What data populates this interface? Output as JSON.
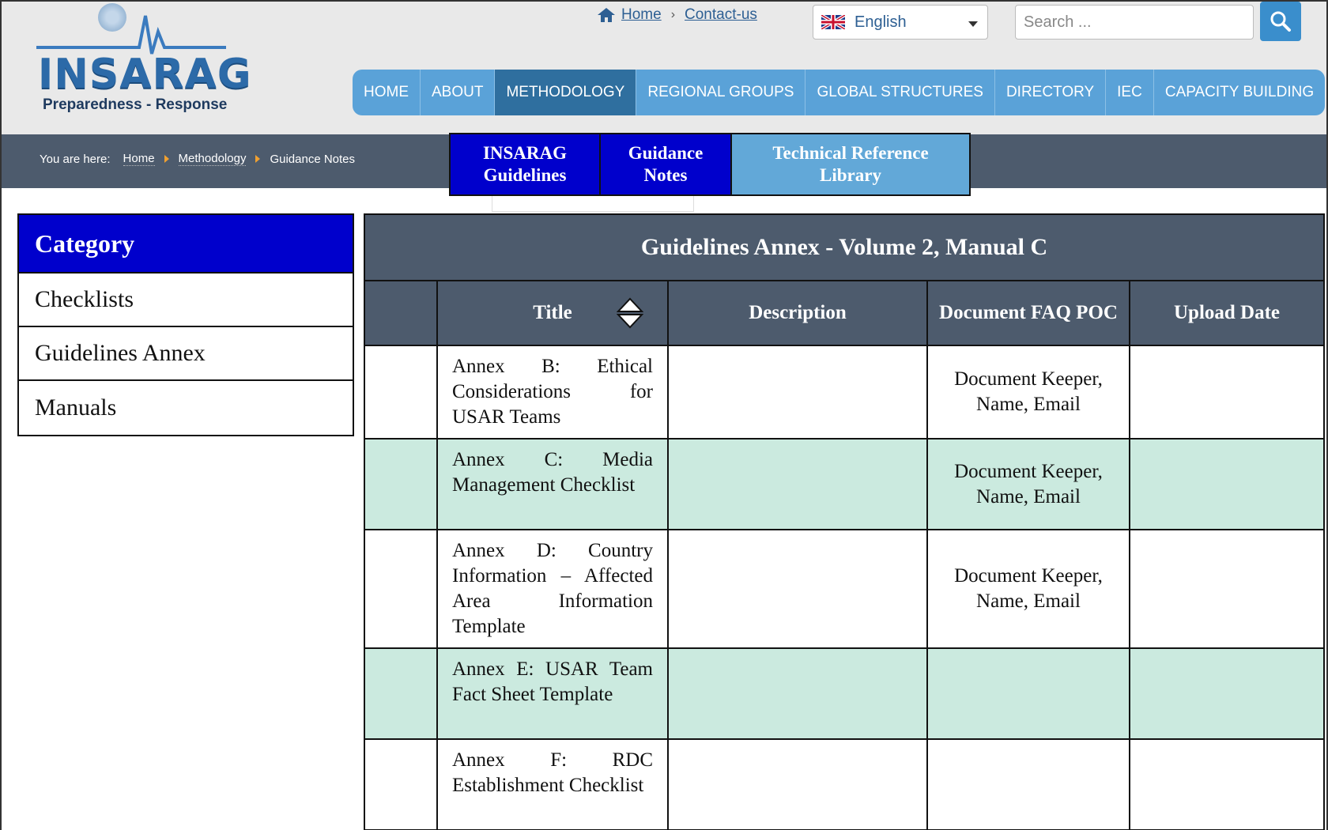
{
  "logo": {
    "wordmark": "INSARAG",
    "tagline": "Preparedness - Response"
  },
  "utility_links": {
    "home": "Home",
    "separator": "›",
    "contact": "Contact-us"
  },
  "language": {
    "selected": "English"
  },
  "search": {
    "placeholder": "Search ..."
  },
  "nav": [
    {
      "label": "HOME"
    },
    {
      "label": "ABOUT"
    },
    {
      "label": "METHODOLOGY",
      "active": true
    },
    {
      "label": "REGIONAL GROUPS"
    },
    {
      "label": "GLOBAL STRUCTURES"
    },
    {
      "label": "DIRECTORY"
    },
    {
      "label": "IEC"
    },
    {
      "label": "CAPACITY BUILDING"
    }
  ],
  "breadcrumb": {
    "prefix": "You are here:",
    "items": [
      "Home",
      "Methodology",
      "Guidance Notes"
    ]
  },
  "subtabs": [
    {
      "label": "INSARAG Guidelines"
    },
    {
      "label": "Guidance Notes"
    },
    {
      "label": "Technical Reference Library"
    }
  ],
  "category": {
    "heading": "Category",
    "items": [
      "Checklists",
      "Guidelines Annex",
      "Manuals"
    ]
  },
  "table": {
    "caption": "Guidelines Annex - Volume 2, Manual C",
    "columns": {
      "title": "Title",
      "description": "Description",
      "poc": "Document FAQ POC",
      "upload": "Upload Date"
    },
    "rows": [
      {
        "title": "Annex B: Ethical Considerations for USAR Teams",
        "description": "",
        "poc": "Document Keeper, Name, Email",
        "upload": ""
      },
      {
        "title": "Annex C: Media Management Checklist",
        "description": "",
        "poc": "Document Keeper, Name, Email",
        "upload": ""
      },
      {
        "title": "Annex D: Country Information – Affected Area Information Template",
        "description": "",
        "poc": "Document Keeper, Name, Email",
        "upload": ""
      },
      {
        "title": "Annex E: USAR Team Fact Sheet Template",
        "description": "",
        "poc": "",
        "upload": ""
      },
      {
        "title": "Annex F: RDC Establishment Checklist",
        "description": "",
        "poc": "",
        "upload": ""
      }
    ]
  },
  "colors": {
    "nav_blue": "#5aa2d8",
    "nav_active": "#2f6f9f",
    "bar_slate": "#4d5b6d",
    "category_blue": "#0000cc",
    "row_alt_green": "#cbeadf"
  },
  "icons": [
    "un-emblem-icon",
    "home-icon",
    "uk-flag-icon",
    "chevron-down-icon",
    "search-icon",
    "sort-icon",
    "breadcrumb-arrow-icon"
  ]
}
